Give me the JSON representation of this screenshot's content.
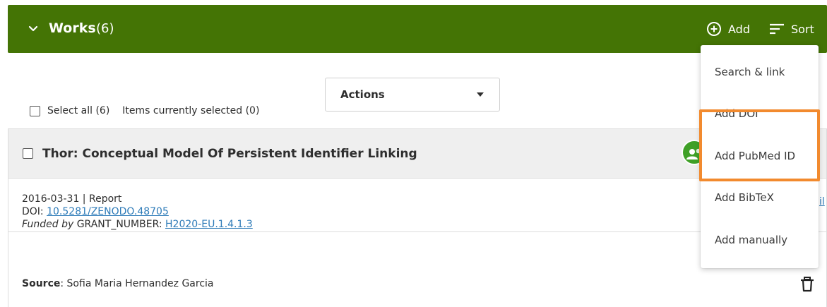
{
  "header": {
    "title": "Works",
    "count": "(6)",
    "add_label": "Add",
    "sort_label": "Sort",
    "background_color": "#447405",
    "icons": {
      "collapse": "chevron-down-icon",
      "add": "plus-circle-icon",
      "sort": "sort-lines-icon"
    }
  },
  "bulk_actions": {
    "select_all_label": "Select all (6)",
    "selected_label": "Items currently selected (0)",
    "actions_label": "Actions"
  },
  "work": {
    "title": "Thor: Conceptual Model Of Persistent Identifier Linking",
    "meta": "2016-03-31 | Report",
    "doi_label": "DOI:",
    "doi_value": "10.5281/ZENODO.48705",
    "funded_prefix": "Funded by",
    "grant_label": "GRANT_NUMBER:",
    "grant_value": "H2020-EU.1.4.1.3",
    "partial_link": "il",
    "source_label": "Source",
    "source_value": ": Sofia Maria Hernandez Garcia",
    "contributor_icon": "users-icon",
    "delete_icon": "trash-icon"
  },
  "add_menu": {
    "items": [
      "Search & link",
      "Add DOI",
      "Add PubMed ID",
      "Add BibTeX",
      "Add manually"
    ],
    "highlight_color": "#f28a2e"
  },
  "colors": {
    "link": "#2e7bb8",
    "contributor_badge": "#3fa027"
  }
}
